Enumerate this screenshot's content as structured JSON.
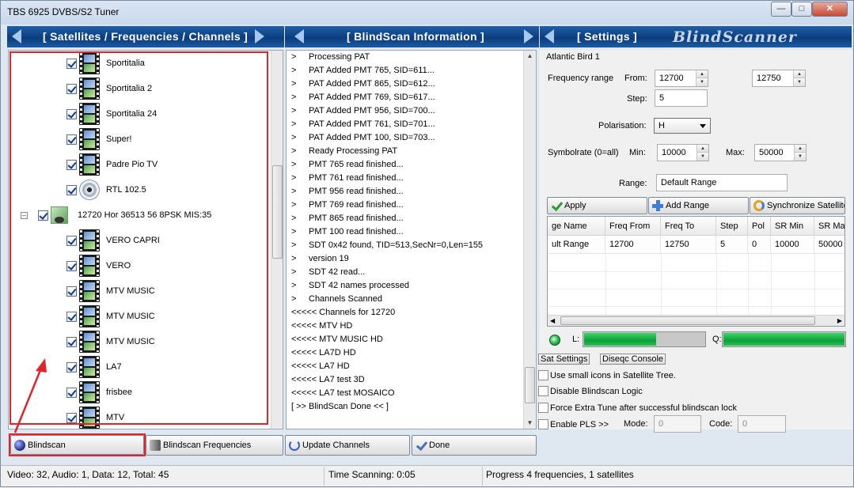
{
  "window": {
    "title": "TBS 6925 DVBS/S2 Tuner",
    "controls": [
      "—",
      "□",
      "✕"
    ]
  },
  "headers": {
    "satellites": "[ Satellites / Frequencies / Channels ]",
    "blindscan_info": "[ BlindScan Information ]",
    "settings": "[ Settings ]",
    "brand": "BlindScanner"
  },
  "tree": {
    "items": [
      {
        "label": "Sportitalia",
        "type": "tv"
      },
      {
        "label": "Sportitalia 2",
        "type": "tv"
      },
      {
        "label": "Sportitalia 24",
        "type": "tv"
      },
      {
        "label": "Super!",
        "type": "tv"
      },
      {
        "label": "Padre Pio TV",
        "type": "tv"
      },
      {
        "label": "RTL 102.5",
        "type": "radio"
      },
      {
        "label": "12720 Hor 36513 56 8PSK MIS:35",
        "type": "transponder"
      },
      {
        "label": "VERO CAPRI",
        "type": "tv"
      },
      {
        "label": "VERO",
        "type": "tv"
      },
      {
        "label": "MTV MUSIC",
        "type": "tv"
      },
      {
        "label": "MTV MUSIC",
        "type": "tv"
      },
      {
        "label": "MTV MUSIC",
        "type": "tv"
      },
      {
        "label": "LA7",
        "type": "tv"
      },
      {
        "label": "frisbee",
        "type": "tv"
      },
      {
        "label": "MTV",
        "type": "tv"
      }
    ]
  },
  "info_log": [
    {
      "prefix": ">",
      "text": "Processing PAT"
    },
    {
      "prefix": ">",
      "text": "PAT Added PMT 765, SID=611..."
    },
    {
      "prefix": ">",
      "text": "PAT Added PMT 865, SID=612..."
    },
    {
      "prefix": ">",
      "text": "PAT Added PMT 769, SID=617..."
    },
    {
      "prefix": ">",
      "text": "PAT Added PMT 956, SID=700..."
    },
    {
      "prefix": ">",
      "text": "PAT Added PMT 761, SID=701..."
    },
    {
      "prefix": ">",
      "text": "PAT Added PMT 100, SID=703..."
    },
    {
      "prefix": ">",
      "text": "Ready Processing PAT"
    },
    {
      "prefix": ">",
      "text": "PMT 765 read finished..."
    },
    {
      "prefix": ">",
      "text": "PMT 761 read finished..."
    },
    {
      "prefix": ">",
      "text": "PMT 956 read finished..."
    },
    {
      "prefix": ">",
      "text": "PMT 769 read finished..."
    },
    {
      "prefix": ">",
      "text": "PMT 865 read finished..."
    },
    {
      "prefix": ">",
      "text": "PMT 100 read finished..."
    },
    {
      "prefix": ">",
      "text": "SDT 0x42 found, TID=513,SecNr=0,Len=155"
    },
    {
      "prefix": ">",
      "text": "version 19"
    },
    {
      "prefix": ">",
      "text": "SDT 42 read..."
    },
    {
      "prefix": ">",
      "text": "SDT 42 names processed"
    },
    {
      "prefix": ">",
      "text": "Channels Scanned"
    },
    {
      "prefix": "",
      "text": "<<<<< Channels for 12720"
    },
    {
      "prefix": "",
      "text": "<<<<< MTV HD"
    },
    {
      "prefix": "",
      "text": "<<<<< MTV MUSIC HD"
    },
    {
      "prefix": "",
      "text": "<<<<< LA7D HD"
    },
    {
      "prefix": "",
      "text": "<<<<< LA7 HD"
    },
    {
      "prefix": "",
      "text": "<<<<< LA7 test 3D"
    },
    {
      "prefix": "",
      "text": "<<<<< LA7 test MOSAICO"
    },
    {
      "prefix": "",
      "text": "[ >> BlindScan Done << ]"
    }
  ],
  "settings": {
    "satellite_name": "Atlantic Bird 1",
    "frequency_range_label": "Frequency range",
    "from_label": "From:",
    "from_value": "12700",
    "to_value": "12750",
    "step_label": "Step:",
    "step_value": "5",
    "polarisation_label": "Polarisation:",
    "polarisation_value": "H",
    "symbolrate_label": "Symbolrate (0=all)",
    "min_label": "Min:",
    "min_value": "10000",
    "max_label": "Max:",
    "max_value": "50000",
    "range_label": "Range:",
    "range_value": "Default Range",
    "apply_label": "Apply",
    "add_range_label": "Add Range",
    "sync_label": "Synchronize Satellite",
    "grid": {
      "columns": [
        "ge Name",
        "Freq From",
        "Freq To",
        "Step",
        "Pol",
        "SR Min",
        "SR Max"
      ],
      "row": [
        "ult Range",
        "12700",
        "12750",
        "5",
        "0",
        "10000",
        "50000"
      ]
    },
    "l_label": "L:",
    "q_label": "Q:",
    "l_level": 0.6,
    "q_level": 1.0,
    "sat_settings_tab": "Sat Settings",
    "diseqc_tab": "Diseqc Console",
    "opt_small_icons": "Use small icons in Satellite Tree.",
    "opt_disable_logic": "Disable Blindscan Logic",
    "opt_force_tune": "Force Extra Tune after successful blindscan lock",
    "opt_enable_pls": "Enable PLS >>",
    "mode_label": "Mode:",
    "mode_value": "0",
    "code_label": "Code:",
    "code_value": "0"
  },
  "actions": {
    "blindscan": "Blindscan",
    "blindscan_freqs": "Blindscan Frequencies",
    "update_channels": "Update Channels",
    "done": "Done"
  },
  "status": {
    "counts": "Video: 32, Audio: 1, Data: 12, Total: 45",
    "time": "Time Scanning: 0:05",
    "progress": "Progress 4 frequencies, 1 satellites"
  },
  "colors": {
    "header_blue": "#0b3d7d",
    "highlight_red": "#e3232b",
    "meter_green": "#0f9e36"
  }
}
